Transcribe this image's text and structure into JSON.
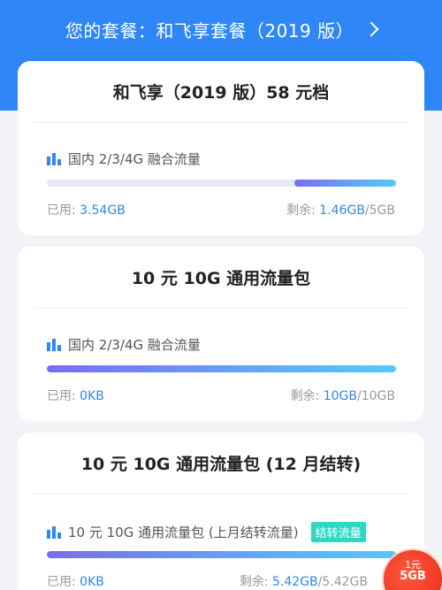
{
  "header": {
    "title": "您的套餐：和飞享套餐（2019 版）"
  },
  "cards": [
    {
      "title": "和飞享（2019 版）58 元档",
      "rows": [
        {
          "label": "国内 2/3/4G 融合流量",
          "used_prefix": "已用: ",
          "used_value": "3.54GB",
          "remain_prefix": "剩余: ",
          "remain_value": "1.46GB",
          "remain_total": "/5GB",
          "remaining_fraction": 0.292
        }
      ]
    },
    {
      "title": "10 元 10G 通用流量包",
      "rows": [
        {
          "label": "国内 2/3/4G 融合流量",
          "used_prefix": "已用: ",
          "used_value": "0KB",
          "remain_prefix": "剩余: ",
          "remain_value": "10GB",
          "remain_total": "/10GB",
          "remaining_fraction": 1.0
        }
      ]
    },
    {
      "title": "10 元 10G 通用流量包 (12 月结转)",
      "rows": [
        {
          "label": "10 元 10G 通用流量包 (上月结转流量)",
          "badge": "结转流量",
          "used_prefix": "已用: ",
          "used_value": "0KB",
          "remain_prefix": "剩余: ",
          "remain_value": "5.42GB",
          "remain_total": "/5.42GB",
          "remaining_fraction": 1.0
        }
      ]
    }
  ],
  "promo": {
    "line1": "1元",
    "line2": "5GB"
  },
  "colors": {
    "header": "#2f86f6",
    "accent_blue": "#2f86f6",
    "badge": "#2fd7c3"
  }
}
